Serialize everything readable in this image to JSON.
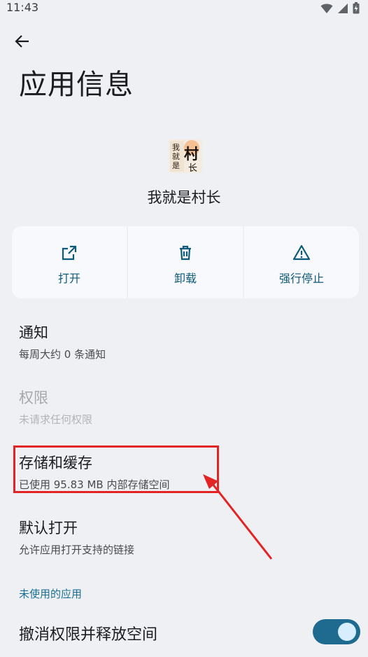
{
  "status_bar": {
    "time": "11:43"
  },
  "header": {
    "title": "应用信息"
  },
  "app": {
    "name": "我就是村长",
    "icon_text_left": "我就是",
    "icon_text_right": "村长"
  },
  "actions": [
    {
      "label": "打开",
      "icon": "open-external-icon"
    },
    {
      "label": "卸载",
      "icon": "trash-icon"
    },
    {
      "label": "强行停止",
      "icon": "warning-icon"
    }
  ],
  "items": {
    "notifications": {
      "title": "通知",
      "subtitle": "每周大约 0 条通知"
    },
    "permissions": {
      "title": "权限",
      "subtitle": "未请求任何权限"
    },
    "storage": {
      "title": "存储和缓存",
      "subtitle": "已使用 95.83 MB 内部存储空间"
    },
    "default_open": {
      "title": "默认打开",
      "subtitle": "允许应用打开支持的链接"
    }
  },
  "unused_apps": {
    "section_title": "未使用的应用",
    "toggle_label": "撤消权限并释放空间",
    "toggle_on": true
  },
  "colors": {
    "accent": "#0d5a79",
    "annotation": "#e32424",
    "background": "#eef0f4"
  }
}
